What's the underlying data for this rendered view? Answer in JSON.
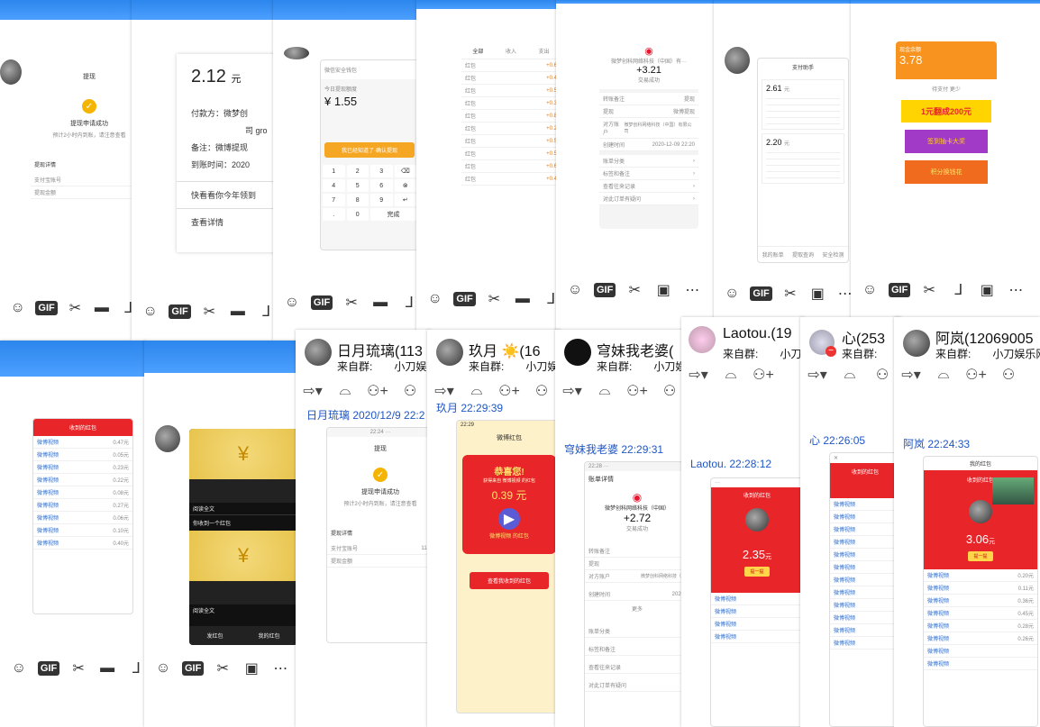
{
  "panels": {
    "p1": {
      "title": "提现",
      "status": "提现申请成功",
      "note": "预计2小时内到账，请注意查看",
      "detail_label": "提现详情",
      "account_label": "支付宝账号",
      "account_partial": "152",
      "amount_label": "提现金额"
    },
    "p2": {
      "amount": "2.12",
      "unit": "元",
      "lines": [
        "付款方：微梦创",
        "司 gro",
        "备注：微博提现",
        "到账时间：2020"
      ],
      "q1": "快看看你今年领到",
      "q2": "查看详情"
    },
    "p3": {
      "brand": "微信安全钱包",
      "amount_label": "今日提现额度",
      "amount": "1.55",
      "confirm": "我已经知道了·确认提现",
      "keys": [
        "1",
        "2",
        "3",
        "4",
        "5",
        "6",
        "7",
        "8",
        "9",
        ".",
        "0",
        "完成"
      ]
    },
    "p4": {
      "tabs": [
        "全部",
        "收入",
        "支出"
      ],
      "items": [
        "红包",
        "红包",
        "红包",
        "红包",
        "红包",
        "红包",
        "红包",
        "红包",
        "红包",
        "红包"
      ],
      "amounts": [
        "+0.6",
        "+0.4",
        "+0.5",
        "+0.3",
        "+0.8",
        "+0.2",
        "+0.5",
        "+0.5",
        "+0.6",
        "+0.4"
      ]
    },
    "p5": {
      "merchant": "微梦创科网络科技（中国）有···",
      "amount": "+3.21",
      "status": "交易成功",
      "fields": [
        "转账备注",
        "提现",
        "对方账户",
        "创建时间"
      ],
      "values": [
        "提现",
        "微博提现",
        "微梦创科网络科技（中国）有限公司",
        "2020-12-09 22:20"
      ],
      "links": [
        "账单分类",
        "标签和备注",
        "查看往来记录",
        "对此订单有疑问"
      ]
    },
    "p6": {
      "title": "支付助手",
      "amount1": "2.61",
      "amount2": "2.20",
      "footer": [
        "我的账单",
        "提取查询",
        "安全检测"
      ]
    },
    "p7": {
      "title": "现金余额",
      "amount": "3.78",
      "btn": "领现金",
      "labels": [
        "待支付 更少",
        "1元翻成200元",
        "签到抽卡大奖",
        "积分换钱花"
      ]
    },
    "p8": {
      "header": "收到的红包",
      "rows": [
        "0.47元",
        "0.05元",
        "0.23元",
        "0.22元",
        "0.08元",
        "0.27元",
        "0.06元",
        "0.10元",
        "0.40元"
      ]
    },
    "p9": {
      "caption1": "阅读全文",
      "line": "你收到一个红包",
      "caption2": "阅读全文",
      "tabs": [
        "发红包",
        "我的红包"
      ]
    },
    "p10": {
      "title": "提现",
      "status": "提现申请成功",
      "note": "预计2小时内到账，请注意查看",
      "detail_label": "提现详情",
      "account_label": "支付宝账号",
      "account_partial": "113",
      "amount_label": "提现金额"
    },
    "p11": {
      "title": "微博红包",
      "congrats": "恭喜您!",
      "sub": "获得来自 微博视频 的红包",
      "amount": "0.39 元",
      "video": "微博视频 的红包",
      "btn": "查看我收到的红包"
    },
    "p12": {
      "title": "账单详情",
      "merchant": "微梦创科网络科技（中国）",
      "amount": "+2.72",
      "status": "交易成功",
      "fields": [
        "转账备注",
        "提现",
        "对方账户",
        "创建时间"
      ],
      "values": [
        "",
        "",
        "微梦创科网络科技（中",
        "2020-"
      ],
      "more": "更多",
      "links": [
        "账单分类",
        "标签和备注",
        "查看往来记录",
        "对此订单有疑问"
      ]
    },
    "p13": {
      "tab": "收到的红包",
      "amount": "2.35",
      "unit": "元",
      "btn": "提一提",
      "rows": [
        "微博视频",
        "微博视频",
        "微博视频",
        "微博视频"
      ]
    },
    "p14": {
      "tab": "收到的红包",
      "rows": [
        "微博视频",
        "微博视频",
        "微博视频",
        "微博视频",
        "微博视频",
        "微博视频",
        "微博视频",
        "微博视频",
        "微博视频",
        "微博视频",
        "微博视频",
        "微博视频"
      ]
    },
    "p15": {
      "tab": "我的红包",
      "header": "收到的红包",
      "amount": "3.06",
      "unit": "元",
      "btn": "提一提",
      "rows": [
        "微博视频",
        "微博视频",
        "微博视频",
        "微博视频",
        "微博视频",
        "微博视频",
        "微博视频",
        "微博视频"
      ],
      "amounts": [
        "0.20元",
        "0.11元",
        "0.36元",
        "0.45元",
        "0.28元",
        "0.26元",
        "",
        ""
      ]
    }
  },
  "chats": [
    {
      "name": "日月琉璃(113",
      "group_label": "来自群:",
      "group": "小刀娱",
      "stamp": "日月琉璃 2020/12/9 22:2"
    },
    {
      "name": "玖月",
      "sun": "☀️(16",
      "group_label": "来自群:",
      "group": "小刀娱",
      "stamp": "玖月   22:29:39",
      "time": "22:29"
    },
    {
      "name": "穹妹我老婆(",
      "group_label": "来自群:",
      "group": "小刀娱",
      "stamp": "穹妹我老婆   22:29:31"
    },
    {
      "name": "Laotou.(19",
      "group_label": "来自群:",
      "group": "小刀",
      "stamp": "Laotou.   22:28:12"
    },
    {
      "name": "心(253",
      "group_label": "来自群:",
      "group": "小刀",
      "stamp": "心   22:26:05"
    },
    {
      "name": "阿岚(12069005",
      "group_label": "来自群:",
      "group": "小刀娱乐网",
      "stamp": "阿岚   22:24:33"
    }
  ]
}
